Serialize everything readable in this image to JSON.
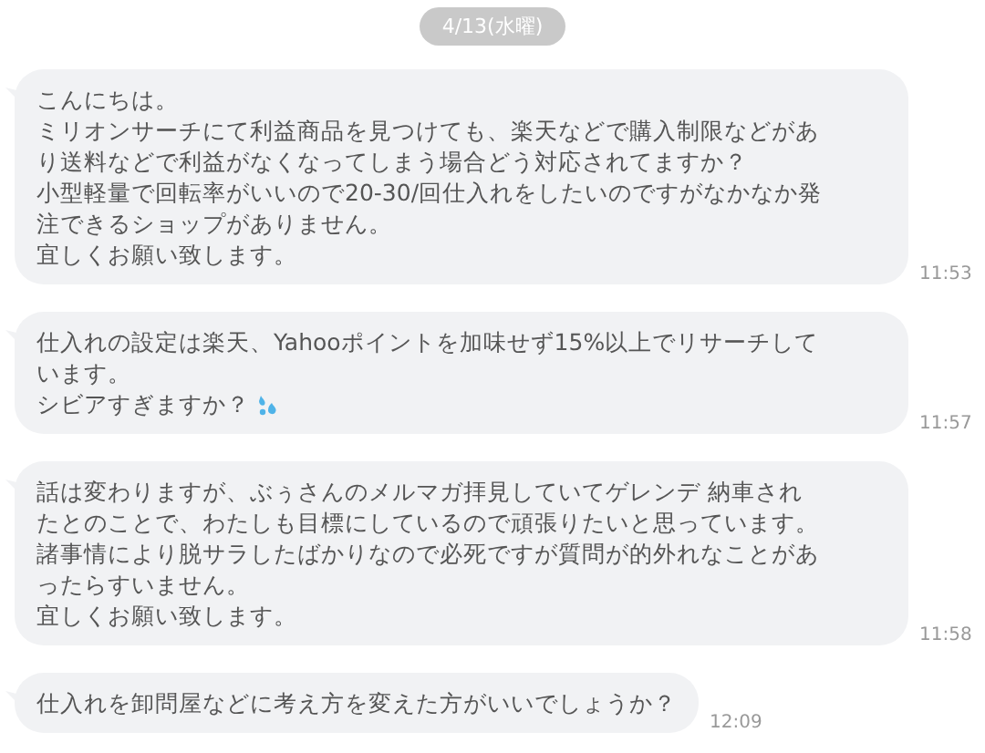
{
  "date_label": "4/13(水曜)",
  "messages": [
    {
      "lines": [
        "こんにちは。",
        "ミリオンサーチにて利益商品を見つけても、楽天などで購入制限などがあ",
        "り送料などで利益がなくなってしまう場合どう対応されてますか？",
        "小型軽量で回転率がいいので20-30/回仕入れをしたいのですがなかなか発",
        "注できるショップがありません。",
        "宜しくお願い致します。"
      ],
      "time": "11:53"
    },
    {
      "lines": [
        "仕入れの設定は楽天、Yahooポイントを加味せず15%以上でリサーチして",
        "います。",
        "シビアすぎますか？"
      ],
      "sweat_icon": true,
      "time": "11:57"
    },
    {
      "lines": [
        "話は変わりますが、ぶぅさんのメルマガ拝見していてゲレンデ 納車され",
        "たとのことで、わたしも目標にしているので頑張りたいと思っています。",
        "諸事情により脱サラしたばかりなので必死ですが質問が的外れなことがあ",
        "ったらすいません。",
        "宜しくお願い致します。"
      ],
      "time": "11:58"
    },
    {
      "lines": [
        "仕入れを卸問屋などに考え方を変えた方がいいでしょうか？"
      ],
      "time": "12:09"
    }
  ]
}
